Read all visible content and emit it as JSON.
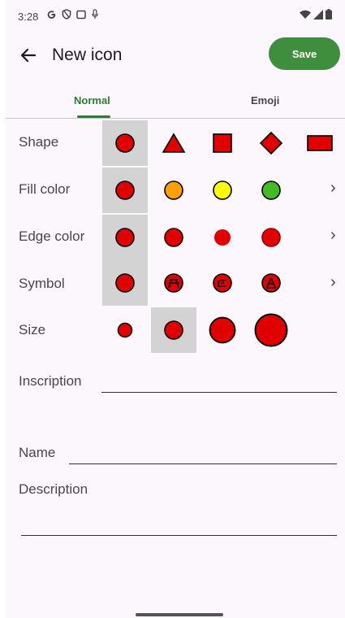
{
  "status_bar": {
    "time": "3:28",
    "left_icons": [
      "google-icon",
      "shield-icon",
      "screen-icon",
      "mic-icon"
    ],
    "right_icons": [
      "wifi-icon",
      "signal-icon",
      "battery-icon"
    ]
  },
  "header": {
    "title": "New icon",
    "save_label": "Save",
    "accent_color": "#3e8e3e"
  },
  "tabs": [
    {
      "label": "Normal",
      "selected": true
    },
    {
      "label": "Emoji",
      "selected": false
    }
  ],
  "rows": {
    "shape": {
      "label": "Shape",
      "options": [
        "circle",
        "triangle",
        "square",
        "diamond",
        "rectangle"
      ],
      "selected": 0
    },
    "fill_color": {
      "label": "Fill color",
      "options": [
        "#e00000",
        "#ff9f00",
        "#ffff00",
        "#44bb22"
      ],
      "selected": 0
    },
    "edge_color": {
      "label": "Edge color",
      "selected": 0
    },
    "symbol": {
      "label": "Symbol",
      "options": [
        "none",
        "picnic-table-icon",
        "tunnel-icon",
        "campfire-icon"
      ],
      "selected": 0
    },
    "size": {
      "label": "Size",
      "options": [
        "small",
        "medium",
        "large",
        "extra-large"
      ],
      "selected": 1
    }
  },
  "fields": {
    "inscription": {
      "label": "Inscription",
      "value": ""
    },
    "name": {
      "label": "Name",
      "value": ""
    },
    "description": {
      "label": "Description",
      "value": ""
    }
  },
  "chevron_glyph": "›"
}
